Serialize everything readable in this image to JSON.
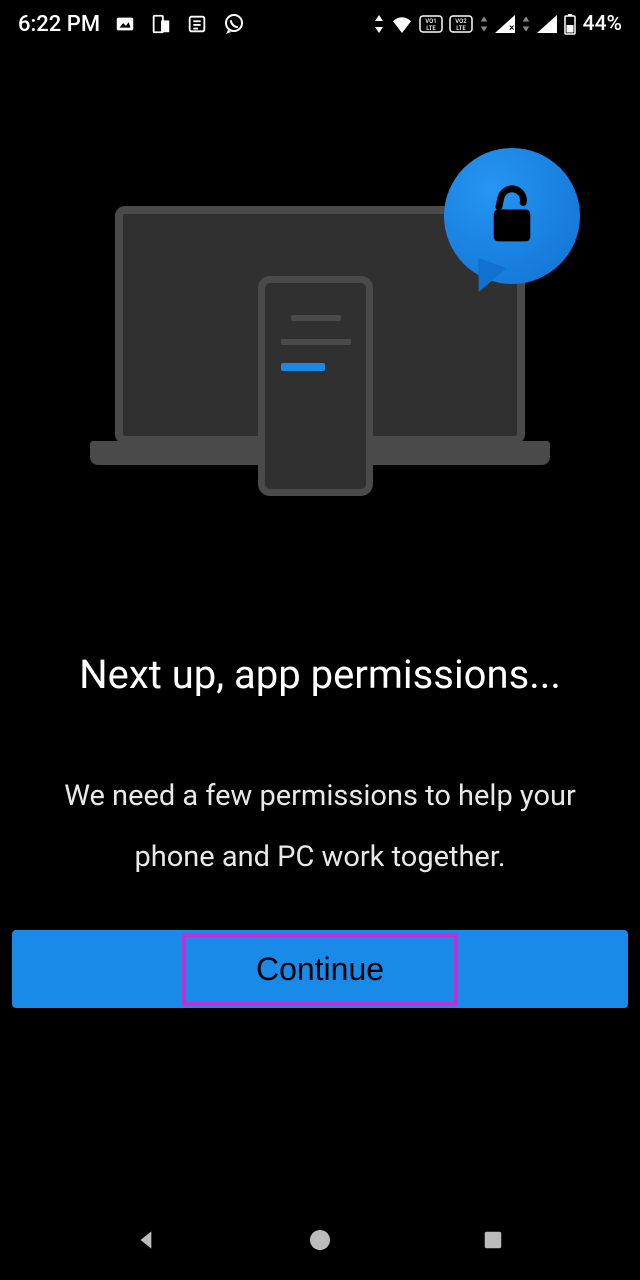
{
  "statusbar": {
    "time": "6:22 PM",
    "battery": "44%"
  },
  "screen": {
    "heading": "Next up, app permissions...",
    "subtext": "We need a few permissions to help your phone and PC work together.",
    "continue_label": "Continue"
  }
}
